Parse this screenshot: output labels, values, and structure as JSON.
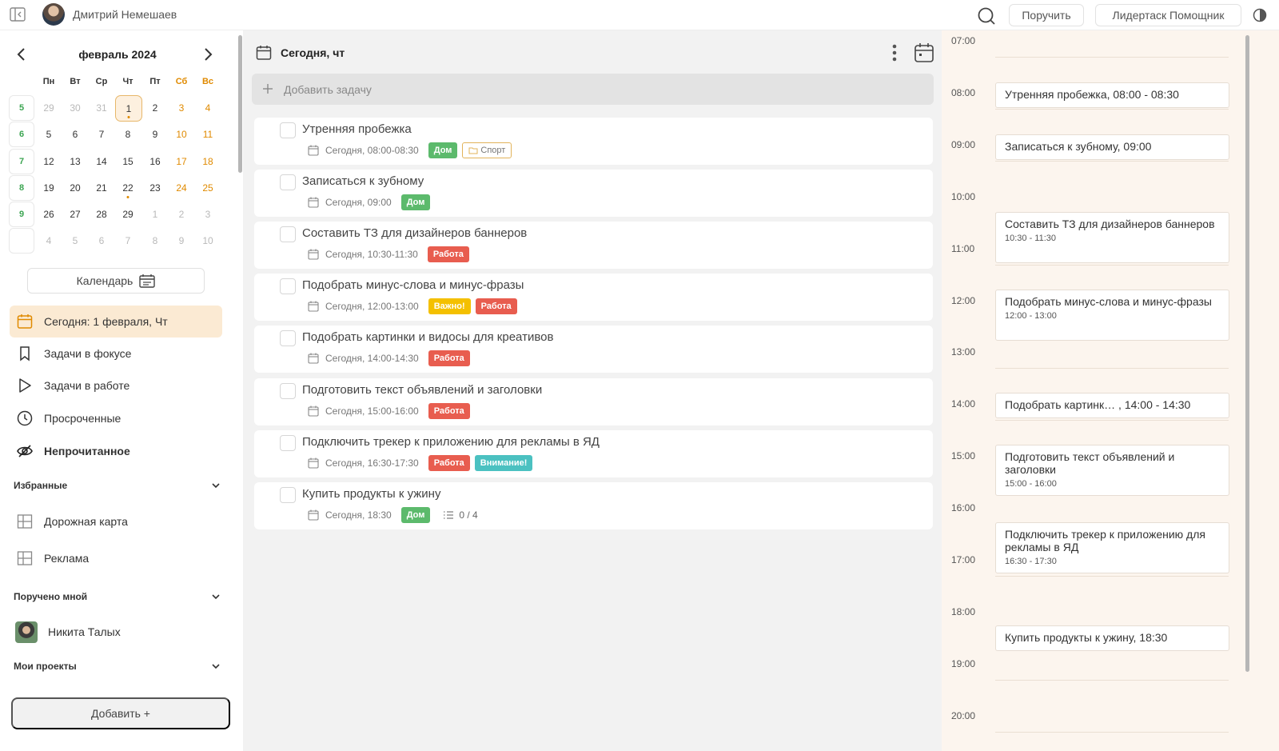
{
  "header": {
    "user_name": "Дмитрий Немешаев",
    "assign_label": "Поручить",
    "assistant_label": "Лидертаск Помощник"
  },
  "calendar": {
    "month": "февраль 2024",
    "weekdays": [
      "Пн",
      "Вт",
      "Ср",
      "Чт",
      "Пт",
      "Сб",
      "Вс"
    ],
    "weeks": [
      {
        "num": "5",
        "days": [
          "29",
          "30",
          "31",
          "1",
          "2",
          "3",
          "4"
        ]
      },
      {
        "num": "6",
        "days": [
          "5",
          "6",
          "7",
          "8",
          "9",
          "10",
          "11"
        ]
      },
      {
        "num": "7",
        "days": [
          "12",
          "13",
          "14",
          "15",
          "16",
          "17",
          "18"
        ]
      },
      {
        "num": "8",
        "days": [
          "19",
          "20",
          "21",
          "22",
          "23",
          "24",
          "25"
        ]
      },
      {
        "num": "9",
        "days": [
          "26",
          "27",
          "28",
          "29",
          "1",
          "2",
          "3"
        ]
      },
      {
        "num": "",
        "days": [
          "4",
          "5",
          "6",
          "7",
          "8",
          "9",
          "10"
        ]
      }
    ],
    "calendar_button": "Календарь"
  },
  "nav": {
    "today": "Сегодня: 1 февраля, Чт",
    "focus": "Задачи в фокусе",
    "in_work": "Задачи в работе",
    "overdue": "Просроченные",
    "unread": "Непрочитанное"
  },
  "sections": {
    "favorites": "Избранные",
    "roadmap": "Дорожная карта",
    "ads": "Реклама",
    "assigned_by_me": "Поручено мной",
    "assignee": "Никита Талых",
    "my_projects": "Мои проекты",
    "add": "Добавить +"
  },
  "main": {
    "title": "Сегодня, чт",
    "add_task_placeholder": "Добавить задачу",
    "tasks": [
      {
        "title": "Утренняя пробежка",
        "date": "Сегодня, 08:00-08:30",
        "tags": [
          {
            "text": "Дом",
            "color": "green"
          },
          {
            "text": "Спорт",
            "color": "outline"
          }
        ]
      },
      {
        "title": "Записаться к зубному",
        "date": "Сегодня, 09:00",
        "tags": [
          {
            "text": "Дом",
            "color": "green"
          }
        ]
      },
      {
        "title": "Составить ТЗ для дизайнеров баннеров",
        "date": "Сегодня, 10:30-11:30",
        "tags": [
          {
            "text": "Работа",
            "color": "red"
          }
        ]
      },
      {
        "title": "Подобрать минус-слова и минус-фразы",
        "date": "Сегодня, 12:00-13:00",
        "tags": [
          {
            "text": "Важно!",
            "color": "yellow"
          },
          {
            "text": "Работа",
            "color": "red"
          }
        ]
      },
      {
        "title": "Подобрать картинки и видосы для креативов",
        "date": "Сегодня, 14:00-14:30",
        "tags": [
          {
            "text": "Работа",
            "color": "red"
          }
        ]
      },
      {
        "title": "Подготовить текст объявлений и заголовки",
        "date": "Сегодня, 15:00-16:00",
        "tags": [
          {
            "text": "Работа",
            "color": "red"
          }
        ]
      },
      {
        "title": "Подключить трекер к приложению для рекламы в ЯД",
        "date": "Сегодня, 16:30-17:30",
        "tags": [
          {
            "text": "Работа",
            "color": "red"
          },
          {
            "text": "Внимание!",
            "color": "teal"
          }
        ]
      },
      {
        "title": "Купить продукты к ужину",
        "date": "Сегодня, 18:30",
        "tags": [
          {
            "text": "Дом",
            "color": "green"
          }
        ],
        "checklist": "0 / 4"
      }
    ]
  },
  "timeline": {
    "hours": [
      "07:00",
      "08:00",
      "09:00",
      "10:00",
      "11:00",
      "12:00",
      "13:00",
      "14:00",
      "15:00",
      "16:00",
      "17:00",
      "18:00",
      "19:00",
      "20:00"
    ],
    "events": [
      {
        "title": "Утренняя пробежка, 08:00 - 08:30",
        "sub": ""
      },
      {
        "title": "Записаться к зубному, 09:00",
        "sub": ""
      },
      {
        "title": "Составить ТЗ для дизайнеров баннеров",
        "sub": "10:30 - 11:30"
      },
      {
        "title": "Подобрать минус-слова и минус-фразы",
        "sub": "12:00 - 13:00"
      },
      {
        "title": "Подобрать картинк… , 14:00 - 14:30",
        "sub": ""
      },
      {
        "title": "Подготовить текст объявлений и заголовки",
        "sub": "15:00 - 16:00"
      },
      {
        "title": "Подключить трекер к приложению для рекламы в ЯД",
        "sub": "16:30 - 17:30"
      },
      {
        "title": "Купить продукты к ужину, 18:30",
        "sub": ""
      }
    ]
  },
  "colors": {
    "accent_orange": "#e08a00",
    "week_green": "#3ca552",
    "tag_green": "#5cba6c",
    "tag_red": "#e85d4f",
    "tag_yellow": "#f4c000",
    "tag_teal": "#4bc1c1",
    "timeline_bg": "#fcf5ee"
  }
}
